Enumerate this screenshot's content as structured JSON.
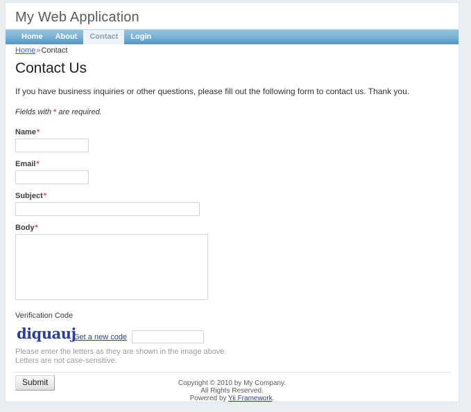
{
  "header": {
    "logo": "My Web Application"
  },
  "nav": {
    "items": [
      {
        "label": "Home",
        "active": false
      },
      {
        "label": "About",
        "active": false
      },
      {
        "label": "Contact",
        "active": true
      },
      {
        "label": "Login",
        "active": false
      }
    ]
  },
  "breadcrumb": {
    "home": "Home",
    "separator": "»",
    "current": "Contact"
  },
  "main": {
    "title": "Contact Us",
    "intro": "If you have business inquiries or other questions, please fill out the following form to contact us. Thank you.",
    "required_note_before": "Fields with ",
    "required_marker": "*",
    "required_note_after": " are required."
  },
  "form": {
    "name": {
      "label": "Name",
      "value": "",
      "required": true
    },
    "email": {
      "label": "Email",
      "value": "",
      "required": true
    },
    "subject": {
      "label": "Subject",
      "value": "",
      "required": true
    },
    "body": {
      "label": "Body",
      "value": "",
      "required": true
    },
    "captcha": {
      "label": "Verification Code",
      "image_text": "diquauj",
      "image_color": "#2b3f93",
      "refresh_link": "Get a new code",
      "value": "",
      "hint_line1": "Please enter the letters as they are shown in the image above.",
      "hint_line2": "Letters are not case-sensitive."
    },
    "submit_label": "Submit"
  },
  "footer": {
    "copyright": "Copyright © 2010 by My Company.",
    "rights": "All Rights Reserved.",
    "powered_prefix": "Powered by ",
    "powered_link": "Yii Framework",
    "powered_suffix": "."
  }
}
